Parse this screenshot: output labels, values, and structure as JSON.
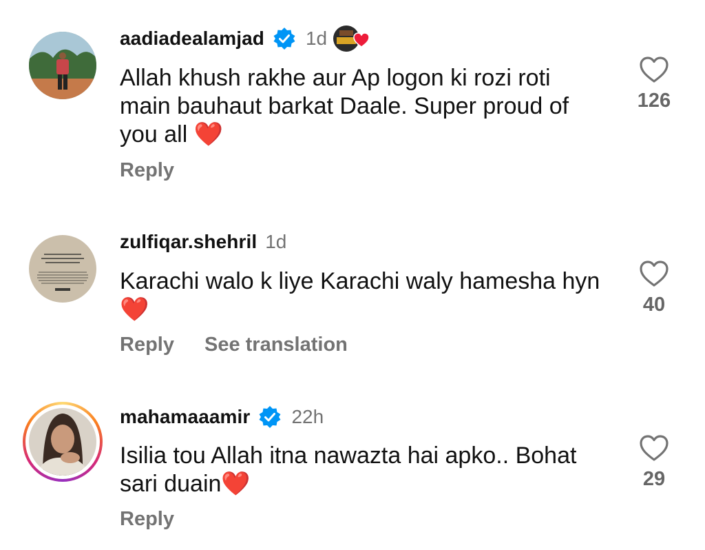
{
  "comments": [
    {
      "username": "aadiadealamjad",
      "verified": true,
      "time": "1d",
      "text": "Allah khush rakhe aur Ap logon ki rozi roti main bauhaut barkat Daale. Super proud of you all ❤️",
      "reply_label": "Reply",
      "like_count": "126",
      "avatar_icon": "man-on-street-photo",
      "creator_liked": true
    },
    {
      "username": "zulfiqar.shehril",
      "verified": false,
      "time": "1d",
      "text": "Karachi walo k liye Karachi  waly hamesha hyn❤️",
      "reply_label": "Reply",
      "translate_label": "See translation",
      "like_count": "40",
      "avatar_icon": "calligraphy-text-image"
    },
    {
      "username": "mahamaaamir",
      "verified": true,
      "time": "22h",
      "text": "Isilia tou Allah itna nawazta hai apko.. Bohat sari duain❤️",
      "reply_label": "Reply",
      "like_count": "29",
      "avatar_icon": "woman-portrait-photo",
      "story_ring": true
    }
  ],
  "colors": {
    "verified": "#0095f6",
    "heart": "#ed1c3a",
    "secondary_text": "#737373"
  }
}
